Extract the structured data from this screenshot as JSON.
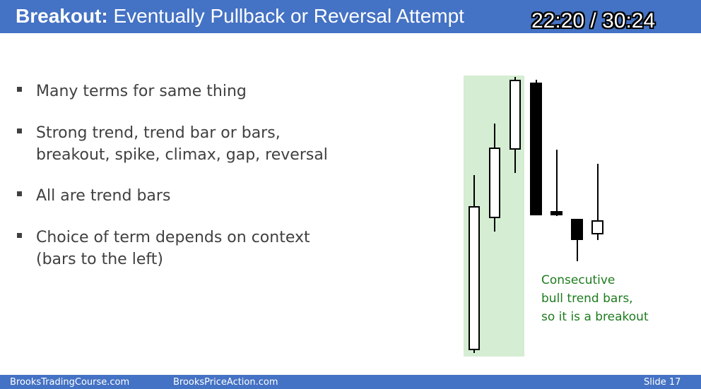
{
  "header": {
    "title_bold": "Breakout:",
    "title_rest": " Eventually Pullback or Reversal Attempt",
    "timer": "22:20 / 30:24"
  },
  "bullets": [
    "Many terms for same thing",
    "Strong trend, trend bar or bars,\nbreakout, spike, climax, gap, reversal",
    "All are trend bars",
    "Choice of term depends on context\n(bars to the left)"
  ],
  "annotation": "Consecutive\nbull trend bars,\nso it is a breakout",
  "footer": {
    "left": "BrooksTradingCourse.com",
    "middle": "BrooksPriceAction.com",
    "slide": "Slide  17"
  },
  "colors": {
    "header_bg": "#4472c4",
    "highlight": "#d5edd2",
    "annotation": "#1e7b1e",
    "text": "#404040"
  }
}
